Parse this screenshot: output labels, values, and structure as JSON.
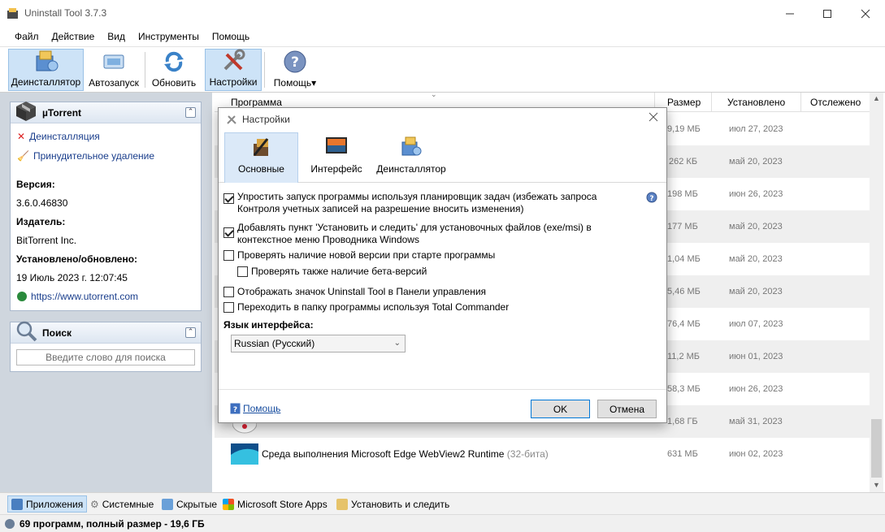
{
  "window": {
    "title": "Uninstall Tool 3.7.3"
  },
  "menu": [
    "Файл",
    "Действие",
    "Вид",
    "Инструменты",
    "Помощь"
  ],
  "toolbar": {
    "uninstaller": "Деинсталлятор",
    "autorun": "Автозапуск",
    "refresh": "Обновить",
    "settings": "Настройки",
    "help": "Помощь"
  },
  "app_info": {
    "name": "µTorrent",
    "uninstall_link": "Деинсталляция",
    "force_remove_link": "Принудительное удаление",
    "version_label": "Версия:",
    "version": "3.6.0.46830",
    "publisher_label": "Издатель:",
    "publisher": "BitTorrent Inc.",
    "installed_label": "Установлено/обновлено:",
    "installed": "19 Июль 2023 г. 12:07:45",
    "website": "https://www.utorrent.com"
  },
  "search": {
    "title": "Поиск",
    "placeholder": "Введите слово для поиска"
  },
  "table": {
    "columns": {
      "program": "Программа",
      "size": "Размер",
      "installed": "Установлено",
      "tracked": "Отслежено"
    },
    "rows": [
      {
        "size": "9,19 МБ",
        "date": "июл 27, 2023"
      },
      {
        "size": "262 КБ",
        "date": "май 20, 2023"
      },
      {
        "size": "198 МБ",
        "date": "июн 26, 2023"
      },
      {
        "size": "177 МБ",
        "date": "май 20, 2023"
      },
      {
        "size": "1,04 МБ",
        "date": "май 20, 2023"
      },
      {
        "size": "5,46 МБ",
        "date": "май 20, 2023"
      },
      {
        "size": "76,4 МБ",
        "date": "июл 07, 2023"
      },
      {
        "size": "11,2 МБ",
        "date": "июн 01, 2023"
      },
      {
        "size": "58,3 МБ",
        "date": "июн 26, 2023"
      },
      {
        "size": "1,68 ГБ",
        "date": "май 31, 2023"
      },
      {
        "name": "Среда выполнения Microsoft Edge WebView2 Runtime",
        "suffix": "(32-бита)",
        "size": "631 МБ",
        "date": "июн 02, 2023"
      }
    ]
  },
  "bottom_tabs": {
    "apps": "Приложения",
    "system": "Системные",
    "hidden": "Скрытые",
    "store": "Microsoft Store Apps",
    "install_track": "Установить и следить"
  },
  "status": {
    "prefix": "69 программ, полный размер - ",
    "total": "19,6 ГБ"
  },
  "dialog": {
    "title": "Настройки",
    "tabs": {
      "general": "Основные",
      "interface": "Интерфейс",
      "uninstaller": "Деинсталлятор"
    },
    "options": {
      "scheduler_l1": "Упростить запуск программы используя планировщик задач (избежать запроса",
      "scheduler_l2": "Контроля учетных записей на разрешение вносить изменения)",
      "context_l1": "Добавлять пункт 'Установить и следить' для установочных файлов (exe/msi) в",
      "context_l2": "контекстное меню Проводника Windows",
      "update_check": "Проверять наличие новой версии при старте программы",
      "beta_check": "Проверять также наличие бета-версий",
      "control_panel": "Отображать значок Uninstall Tool в Панели управления",
      "total_commander": "Переходить в папку программы используя Total Commander"
    },
    "language_label": "Язык интерфейса:",
    "language_value": "Russian (Русский)",
    "help_link": "Помощь",
    "ok": "OK",
    "cancel": "Отмена"
  }
}
